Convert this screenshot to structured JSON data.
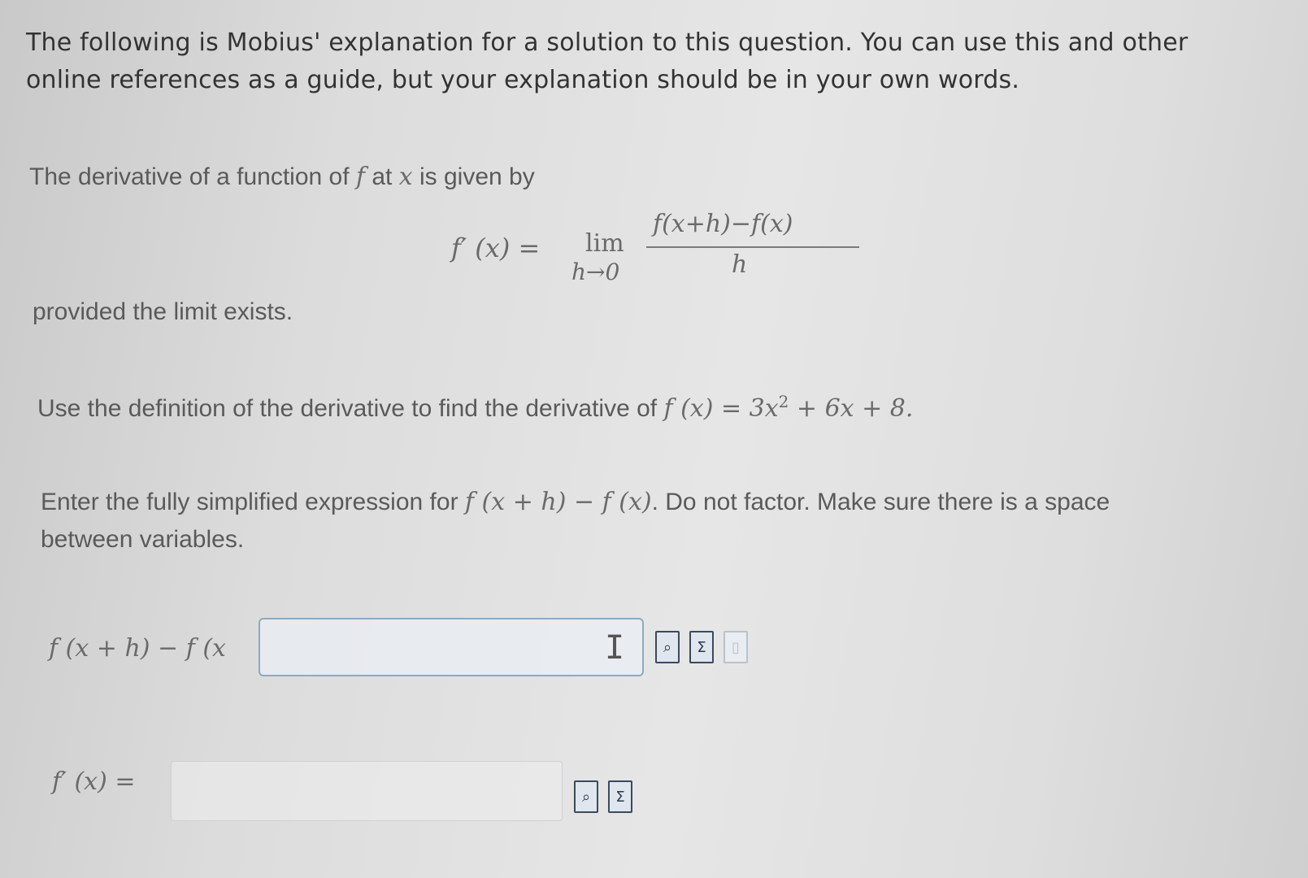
{
  "intro": {
    "text": "The following is Mobius' explanation for a solution to this question. You can use this and other online references as a guide, but your explanation should be in your own words."
  },
  "definition": {
    "lead_text_1": "The derivative of a function of ",
    "f_symbol": "f",
    "lead_text_2": " at ",
    "x_symbol": "x",
    "lead_text_3": " is given by",
    "formula_lhs": "f′ (x) =",
    "formula_lim": "lim",
    "formula_lim_sub": "h→0",
    "formula_numerator": "f(x+h)−f(x)",
    "formula_denominator": "h",
    "provided_text": "provided the limit exists."
  },
  "question": {
    "use_text": "Use the definition of the derivative to find the derivative of ",
    "function_lhs": "f (x) = 3x",
    "exponent": "2",
    "function_rhs": " + 6x + 8."
  },
  "instructions": {
    "enter_text": "Enter the fully simplified expression for ",
    "enter_expr": "f (x + h) − f (x)",
    "enter_rest": ". Do not factor. Make sure there is a space between variables."
  },
  "answer1": {
    "label": "f (x + h) − f (x",
    "value": "",
    "preview_icon": "preview-icon",
    "sum_icon": "sum-icon",
    "extra_icon": "faded-tool-icon"
  },
  "answer2": {
    "label": "f′ (x) =",
    "value": "",
    "preview_icon": "preview-icon",
    "sum_icon": "sum-icon"
  }
}
